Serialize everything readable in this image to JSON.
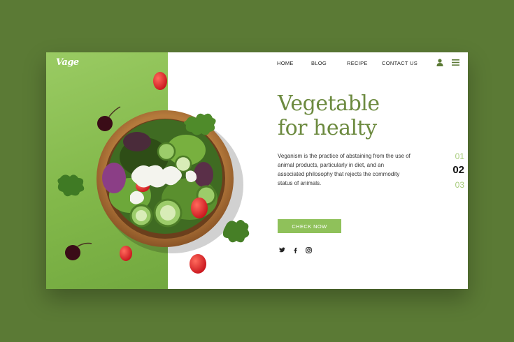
{
  "brand": {
    "logo_text": "Vage"
  },
  "nav": {
    "items": [
      {
        "label": "HOME"
      },
      {
        "label": "BLOG"
      },
      {
        "label": "RECIPE"
      },
      {
        "label": "CONTACT US"
      }
    ],
    "icons": [
      "user-icon",
      "hamburger-menu-icon"
    ]
  },
  "hero": {
    "title_line1": "Vegetable",
    "title_line2": "for healty",
    "description": "Veganism is the practice of abstaining from the use of animal products, particularly in diet, and an associated philosophy that rejects the commodity status of animals.",
    "cta_label": "CHECK NOW"
  },
  "social": [
    "twitter-icon",
    "facebook-icon",
    "instagram-icon"
  ],
  "pagination": {
    "items": [
      "01",
      "02",
      "03"
    ],
    "active": "02"
  },
  "colors": {
    "page_bg": "#5b7a35",
    "accent_green": "#8fc15a",
    "headline_green": "#6c8a3f",
    "pager_inactive": "#a8cc7c"
  }
}
